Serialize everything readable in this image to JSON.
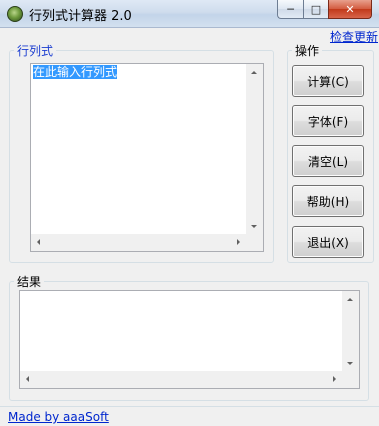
{
  "window": {
    "title": "行列式计算器 2.0",
    "controls": {
      "minimize": "─",
      "maximize": "□",
      "close": "✕"
    }
  },
  "header": {
    "check_update_link": "检查更新"
  },
  "matrix_group": {
    "label": "行列式",
    "input_value": "在此输入行列式"
  },
  "operations_group": {
    "label": "操作",
    "buttons": [
      {
        "label": "计算(C)"
      },
      {
        "label": "字体(F)"
      },
      {
        "label": "清空(L)"
      },
      {
        "label": "帮助(H)"
      },
      {
        "label": "退出(X)"
      }
    ]
  },
  "result_group": {
    "label": "结果",
    "value": ""
  },
  "footer": {
    "made_by_link": "Made by aaaSoft"
  },
  "colors": {
    "link": "#0026ce",
    "selection": "#3399ff",
    "window_bg": "#f0f0f0",
    "close_button": "#c1391a"
  }
}
